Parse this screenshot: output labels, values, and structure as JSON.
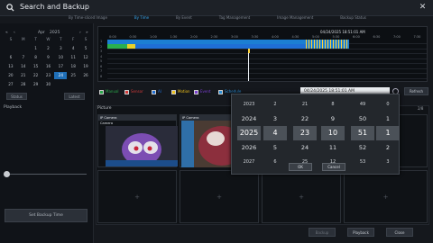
{
  "window": {
    "title": "Search and Backup",
    "close_glyph": "✕"
  },
  "tabs": [
    {
      "label": "By Time-sliced Image",
      "active": false
    },
    {
      "label": "By Time",
      "active": true
    },
    {
      "label": "By Event",
      "active": false
    },
    {
      "label": "Tag Management",
      "active": false
    },
    {
      "label": "Image Management",
      "active": false
    },
    {
      "label": "Backup Status",
      "active": false
    }
  ],
  "calendar": {
    "month": "Apr",
    "year": "2025",
    "prev": "«",
    "prev_small": "‹",
    "next_small": "›",
    "next": "»",
    "weekdays": [
      "S",
      "M",
      "T",
      "W",
      "T",
      "F",
      "S"
    ],
    "cells": [
      "",
      "",
      "1",
      "2",
      "3",
      "4",
      "5",
      "6",
      "7",
      "8",
      "9",
      "10",
      "11",
      "12",
      "13",
      "14",
      "15",
      "16",
      "17",
      "18",
      "19",
      "20",
      "21",
      "22",
      "23",
      "24",
      "25",
      "26",
      "27",
      "28",
      "29",
      "30",
      "",
      "",
      ""
    ],
    "highlight_day": "24",
    "buttons": {
      "left": "Status",
      "right": "Latest"
    }
  },
  "playback_label": "Playback",
  "set_backup_button": "Set Backup Time",
  "timeline": {
    "date_label": "04/24/2025 18:51:01 AM",
    "times": [
      "0:00",
      "0:30",
      "1:00",
      "1:30",
      "2:00",
      "2:30",
      "3:00",
      "3:30",
      "4:00",
      "4:30",
      "5:00",
      "5:30",
      "6:00",
      "6:30",
      "7:00",
      "7:30"
    ],
    "rows": [
      "1",
      "2",
      "3",
      "4",
      "5",
      "6",
      "7",
      "8"
    ]
  },
  "legend": [
    {
      "label": "Manual",
      "color": "#2aa84a"
    },
    {
      "label": "Sensor",
      "color": "#d23a3a"
    },
    {
      "label": "AI",
      "color": "#1f6fd6"
    },
    {
      "label": "Motion",
      "color": "#f0c21a"
    },
    {
      "label": "Event",
      "color": "#7a3fd0"
    },
    {
      "label": "Schedule",
      "color": "#2a8fd9"
    }
  ],
  "datetime_field": "04/24/2025 18:51:01 AM",
  "refresh_button": "Refresh",
  "picture": {
    "title": "Picture",
    "count": "2/8",
    "camera_label": "IP Camera",
    "tiles_labels": [
      "Camera",
      "Camera"
    ]
  },
  "bottom_buttons": {
    "backup": "Backup",
    "playback": "Playback",
    "close": "Close"
  },
  "picker": {
    "columns": [
      [
        "2023",
        "2024",
        "2025",
        "2026",
        "2027"
      ],
      [
        "2",
        "3",
        "4",
        "5",
        "6"
      ],
      [
        "21",
        "22",
        "23",
        "24",
        "25"
      ],
      [
        "8",
        "9",
        "10",
        "11",
        "12"
      ],
      [
        "49",
        "50",
        "51",
        "52",
        "53"
      ],
      [
        "0",
        "1",
        "1",
        "2",
        "3"
      ]
    ],
    "labels": [
      "Y",
      "M",
      "D",
      "H",
      "M",
      "S"
    ],
    "ok": "OK",
    "cancel": "Cancel"
  }
}
